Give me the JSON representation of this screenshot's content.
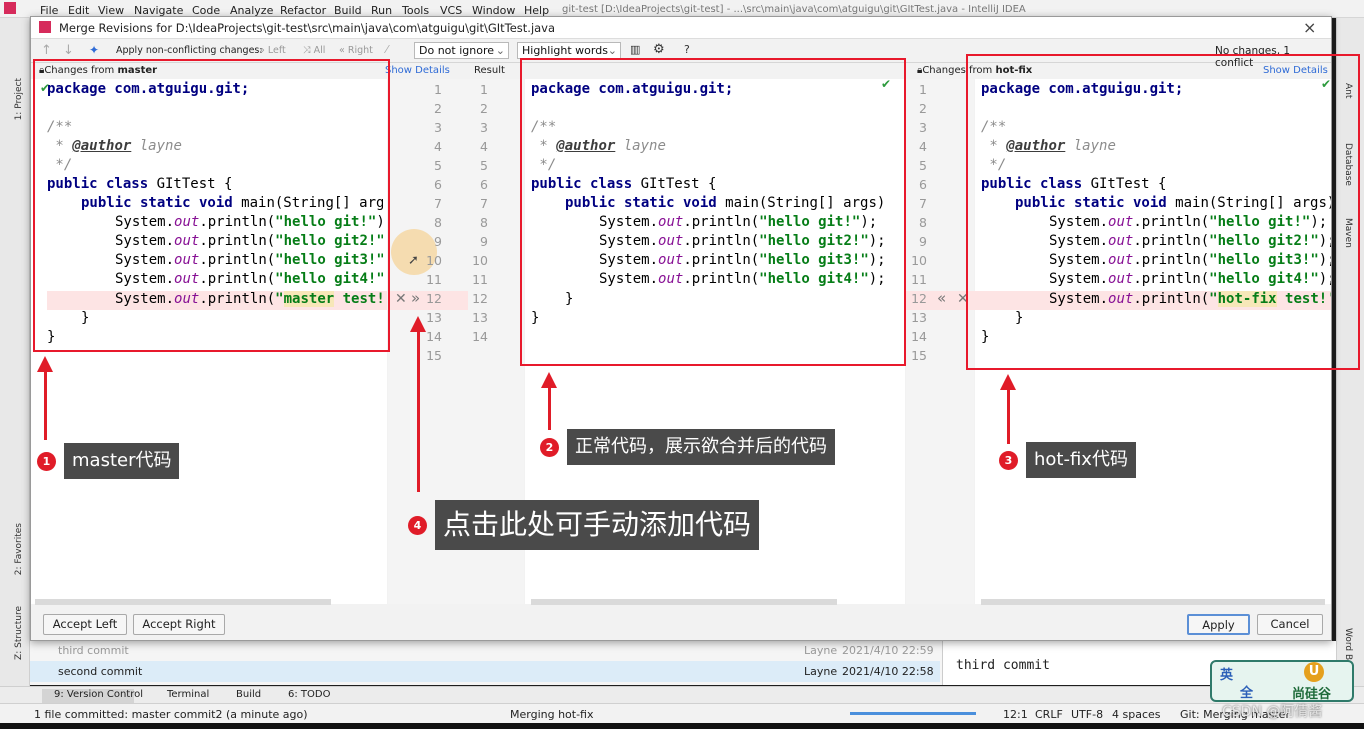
{
  "ide": {
    "menu": [
      "File",
      "Edit",
      "View",
      "Navigate",
      "Code",
      "Analyze",
      "Refactor",
      "Build",
      "Run",
      "Tools",
      "VCS",
      "Window",
      "Help"
    ],
    "window_title": "git-test [D:\\IdeaProjects\\git-test] - ...\\src\\main\\java\\com\\atguigu\\git\\GItTest.java - IntelliJ IDEA",
    "left_tools": [
      "1: Project",
      "2: Favorites",
      "Z: Structure"
    ],
    "right_tools": [
      "Ant",
      "Database",
      "Maven",
      "Word B"
    ],
    "log_rows": [
      {
        "msg": "third commit",
        "author": "Layne",
        "date": "2021/4/10 22:59"
      },
      {
        "msg": "second commit",
        "author": "Layne",
        "date": "2021/4/10 22:58"
      }
    ],
    "commit_detail": "third commit",
    "tool_tabs": [
      "9: Version Control",
      "Terminal",
      "Build",
      "6: TODO"
    ],
    "status": {
      "left": "1 file committed: master commit2 (a minute ago)",
      "task": "Merging hot-fix",
      "pos": "12:1",
      "eol": "CRLF",
      "enc": "UTF-8",
      "indent": "4 spaces",
      "branch": "Git: Merging master"
    },
    "watermark": "CSDN @阿倩酱",
    "ime": {
      "a": "英",
      "b": "全",
      "logo_text": "尚硅谷"
    }
  },
  "dialog": {
    "title": "Merge Revisions for D:\\IdeaProjects\\git-test\\src\\main\\java\\com\\atguigu\\git\\GItTest.java",
    "close": "×",
    "toolbar": {
      "apply_label": "Apply non-conflicting changes:",
      "left": "Left",
      "all": "All",
      "right": "Right",
      "ignore": "Do not ignore",
      "highlight": "Highlight words",
      "help": "?",
      "status": "No changes, 1 conflict"
    },
    "left_header_prefix": "Changes from ",
    "left_header_branch": "master",
    "show_details": "Show Details",
    "result_header": "Result",
    "right_header_prefix": "Changes from ",
    "right_header_branch": "hot-fix",
    "buttons": {
      "accept_left": "Accept Left",
      "accept_right": "Accept Right",
      "apply": "Apply",
      "cancel": "Cancel"
    }
  },
  "code": {
    "line1": "package com.atguigu.git;",
    "doc_open": "/**",
    "doc_star": " * ",
    "doc_tag": "@author",
    "doc_author": " layne",
    "doc_close": " */",
    "cls_kw": "public class ",
    "cls_name": "GItTest {",
    "main_kw": "public static void ",
    "main_sig": "main(String[] args)",
    "sys": "System.",
    "out": "out",
    "println": ".println(",
    "s1": "\"hello git!\"",
    "s2": "\"hello git2!\"",
    "s3": "\"hello git3!\"",
    "s4": "\"hello git4!\"",
    "end": ");",
    "master_str_a": "\"",
    "master_str_b": "master",
    "master_str_c": " test!",
    "hotfix_str_a": "\"",
    "hotfix_str_b": "hot-fix",
    "hotfix_str_c": " test!'",
    "brace_in": "}",
    "brace_out": "}"
  },
  "annotations": [
    {
      "num": "1",
      "text": "master代码"
    },
    {
      "num": "2",
      "text": "正常代码，展示欲合并后的代码"
    },
    {
      "num": "3",
      "text": "hot-fix代码"
    },
    {
      "num": "4",
      "text": "点击此处可手动添加代码"
    }
  ]
}
